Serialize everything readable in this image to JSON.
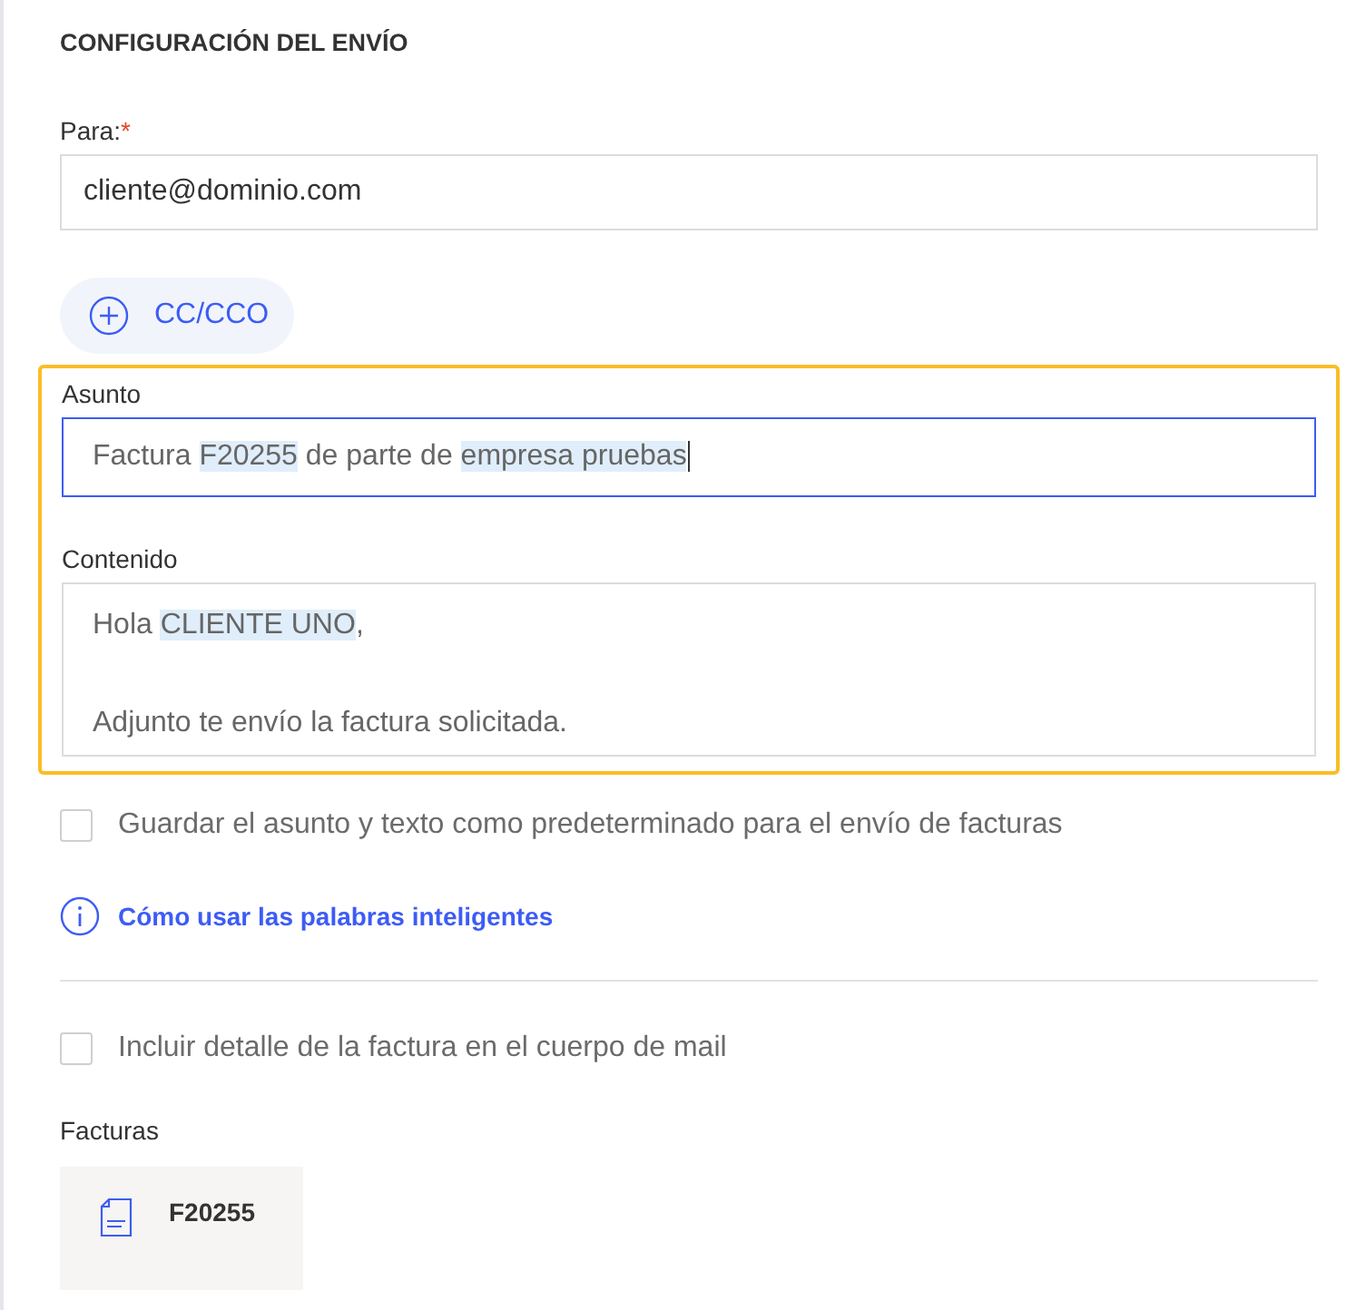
{
  "heading": "CONFIGURACIÓN DEL ENVÍO",
  "to": {
    "label": "Para:",
    "required_mark": "*",
    "value": "cliente@dominio.com"
  },
  "cc_button": {
    "label": "CC/CCO"
  },
  "template_panel": {
    "highlighted": true,
    "subject": {
      "label": "Asunto",
      "focused": true,
      "segments": [
        {
          "text": "Factura ",
          "smart": false
        },
        {
          "text": "F20255",
          "smart": true
        },
        {
          "text": " de parte de ",
          "smart": false
        },
        {
          "text": "empresa pruebas",
          "smart": true
        }
      ]
    },
    "content": {
      "label": "Contenido",
      "paragraphs": [
        {
          "segments": [
            {
              "text": "Hola ",
              "smart": false
            },
            {
              "text": "CLIENTE UNO",
              "smart": true
            },
            {
              "text": ",",
              "smart": false
            }
          ]
        },
        {
          "segments": [
            {
              "text": "Adjunto te envío la factura solicitada.",
              "smart": false
            }
          ]
        }
      ]
    }
  },
  "save_default": {
    "label": "Guardar el asunto y texto como predeterminado para el envío de facturas",
    "checked": false
  },
  "help_link": {
    "label": "Cómo usar las palabras inteligentes"
  },
  "include_detail": {
    "label": "Incluir detalle de la factura en el cuerpo de mail",
    "checked": false
  },
  "invoices": {
    "label": "Facturas",
    "items": [
      {
        "number": "F20255"
      }
    ]
  }
}
